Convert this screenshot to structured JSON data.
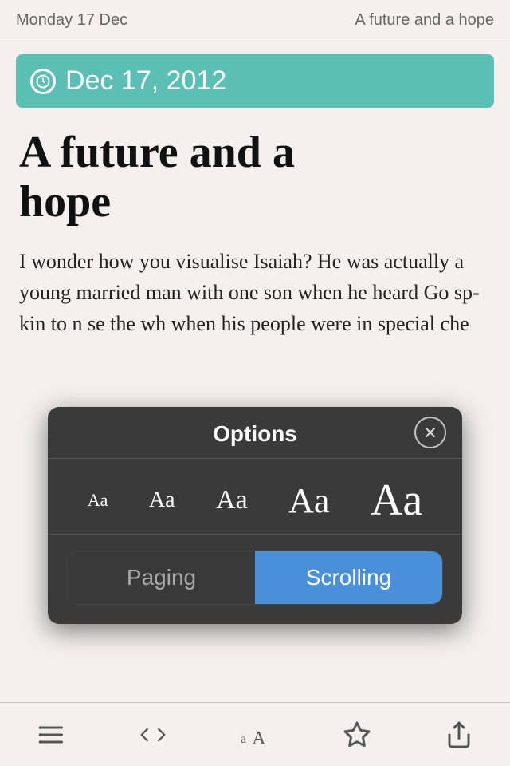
{
  "topBar": {
    "date": "Monday 17 Dec",
    "title": "A future and a hope"
  },
  "dateBadge": {
    "text": "Dec 17, 2012"
  },
  "article": {
    "title": "A future and a hope",
    "body": "I wonder how you visualise Isaiah? He was actually a young married man with one son when he heard Go... sp... kin... to n... se... the wh... when his people were in special che..."
  },
  "options": {
    "title": "Options",
    "closeBtnLabel": "✕",
    "fontSizes": [
      {
        "label": "Aa",
        "size": 22
      },
      {
        "label": "Aa",
        "size": 28
      },
      {
        "label": "Aa",
        "size": 34
      },
      {
        "label": "Aa",
        "size": 44
      },
      {
        "label": "Aa",
        "size": 56
      }
    ],
    "toggleOptions": [
      {
        "label": "Paging",
        "active": false
      },
      {
        "label": "Scrolling",
        "active": true
      }
    ]
  },
  "bottomToolbar": {
    "items": [
      {
        "name": "list-icon",
        "label": "≡"
      },
      {
        "name": "nav-icon",
        "label": "◁▷"
      },
      {
        "name": "font-icon",
        "label": "aA"
      },
      {
        "name": "bookmark-icon",
        "label": "☆"
      },
      {
        "name": "share-icon",
        "label": "⬡"
      }
    ]
  }
}
